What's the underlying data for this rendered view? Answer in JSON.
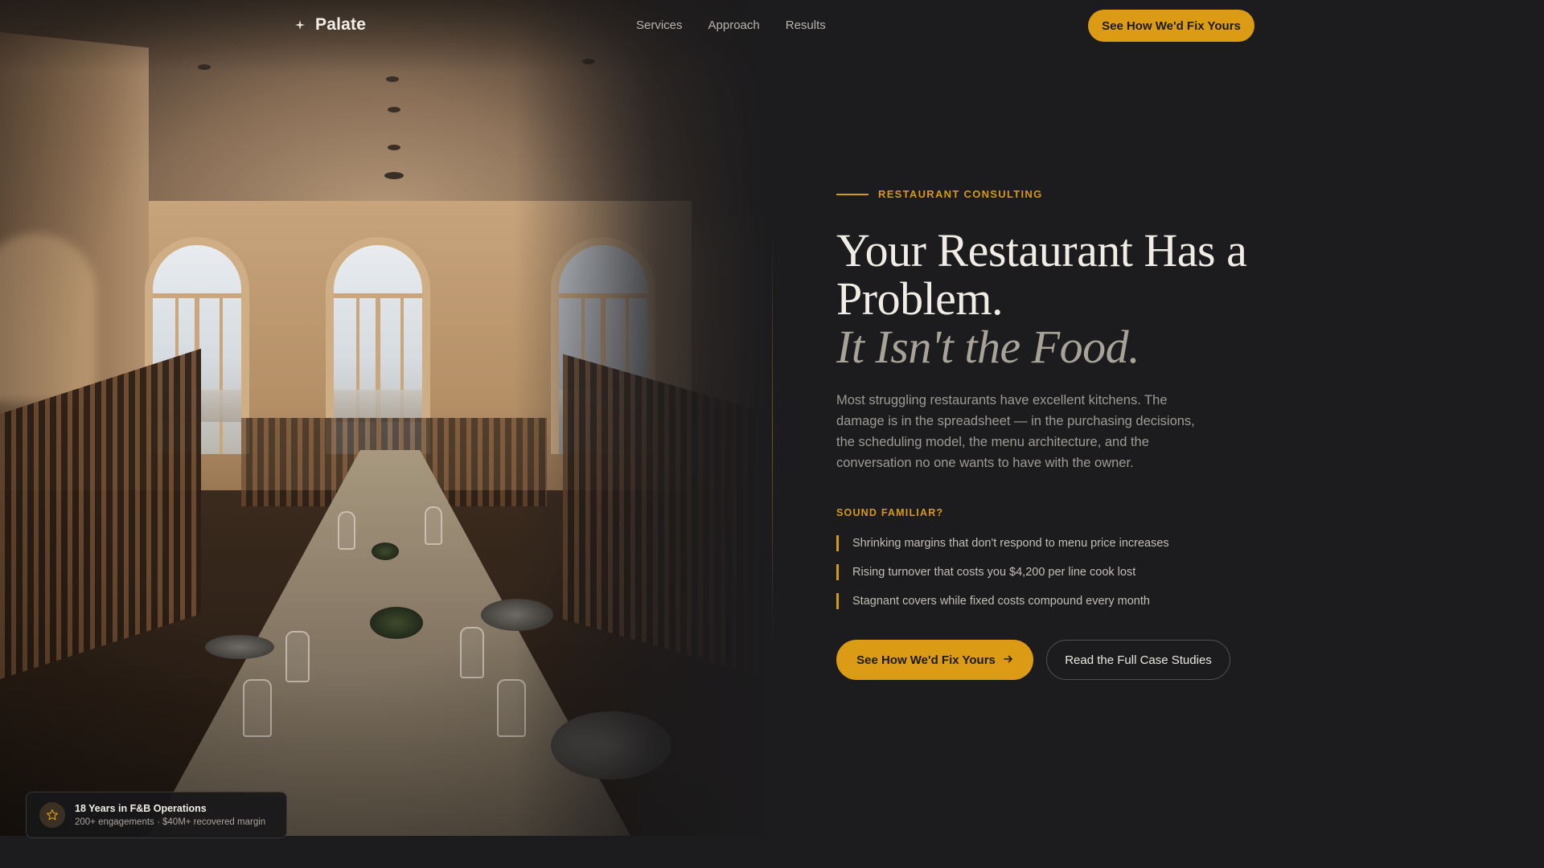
{
  "brand": {
    "name": "Palate",
    "icon": "sparkle-icon"
  },
  "nav": {
    "links": [
      "Services",
      "Approach",
      "Results"
    ],
    "cta_label": "See How We'd Fix Yours"
  },
  "hero": {
    "eyebrow": "RESTAURANT CONSULTING",
    "headline_line1": "Your Restaurant Has a",
    "headline_line2": "Problem.",
    "headline_italic": "It Isn't the Food.",
    "body": "Most struggling restaurants have excellent kitchens. The damage is in the spreadsheet — in the purchasing decisions, the scheduling model, the menu architecture, and the conversation no one wants to have with the owner.",
    "kicker": "SOUND FAMILIAR?",
    "pain_points": [
      "Shrinking margins that don't respond to menu price increases",
      "Rising turnover that costs you $4,200 per line cook lost",
      "Stagnant covers while fixed costs compound every month"
    ],
    "primary_cta": "See How We'd Fix Yours",
    "secondary_cta": "Read the Full Case Studies"
  },
  "badge": {
    "title": "18 Years in F&B Operations",
    "subtitle": "200+ engagements · $40M+ recovered margin",
    "icon": "star-icon"
  },
  "colors": {
    "accent": "#dc9b14",
    "background": "#1c1b1d",
    "text": "#f1ede6",
    "muted": "#9f9b94"
  }
}
